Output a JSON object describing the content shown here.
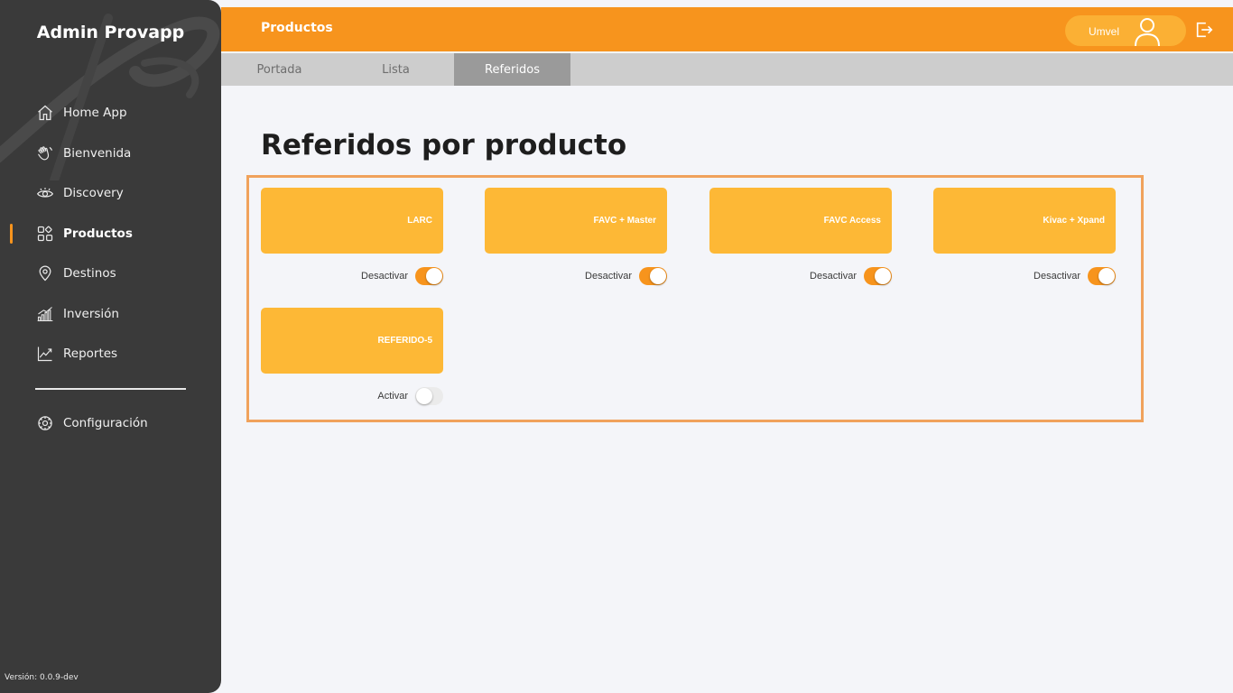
{
  "sidebar": {
    "brand": "Admin Provapp",
    "items": [
      {
        "label": "Home App",
        "icon": "home-icon"
      },
      {
        "label": "Bienvenida",
        "icon": "wave-hand-icon"
      },
      {
        "label": "Discovery",
        "icon": "eye-icon"
      },
      {
        "label": "Productos",
        "icon": "grid-icon"
      },
      {
        "label": "Destinos",
        "icon": "map-pin-icon"
      },
      {
        "label": "Inversión",
        "icon": "bar-chart-icon"
      },
      {
        "label": "Reportes",
        "icon": "line-chart-icon"
      }
    ],
    "active_item": "Productos",
    "config_label": "Configuración",
    "version": "Versión: 0.0.9-dev"
  },
  "header": {
    "title": "Productos",
    "user_name": "Umvel"
  },
  "tabs": [
    {
      "label": "Portada"
    },
    {
      "label": "Lista"
    },
    {
      "label": "Referidos"
    }
  ],
  "active_tab": "Referidos",
  "main": {
    "title": "Referidos por producto",
    "products": [
      {
        "name": "LARC",
        "toggle_label": "Desactivar",
        "enabled": true
      },
      {
        "name": "FAVC + Master",
        "toggle_label": "Desactivar",
        "enabled": true
      },
      {
        "name": "FAVC Access",
        "toggle_label": "Desactivar",
        "enabled": true
      },
      {
        "name": "Kivac + Xpand",
        "toggle_label": "Desactivar",
        "enabled": true
      },
      {
        "name": "REFERIDO-5",
        "toggle_label": "Activar",
        "enabled": false
      }
    ]
  },
  "colors": {
    "accent": "#f7941d",
    "card": "#fdb836",
    "sidebar": "#3a3a3a",
    "panel_border": "#f0a25c"
  }
}
